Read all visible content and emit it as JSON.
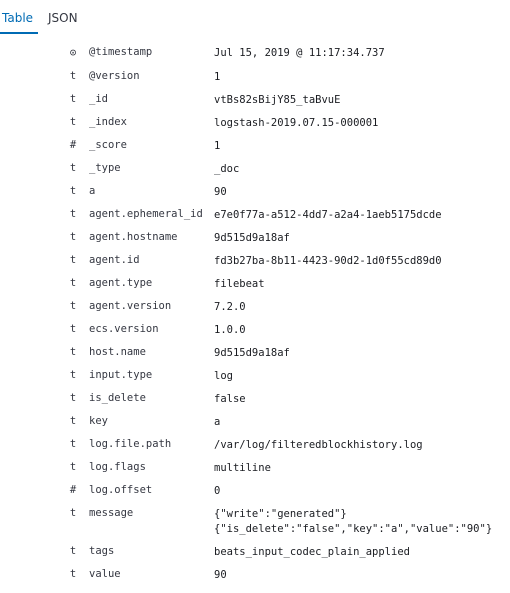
{
  "tabs": {
    "table": "Table",
    "json": "JSON"
  },
  "icons": {
    "date": "clock-icon",
    "string": "t",
    "number": "#"
  },
  "rows": [
    {
      "type": "⊙",
      "field": "@timestamp",
      "value": "Jul 15, 2019 @ 11:17:34.737"
    },
    {
      "type": "t",
      "field": "@version",
      "value": "1"
    },
    {
      "type": "t",
      "field": "_id",
      "value": "vtBs82sBijY85_taBvuE"
    },
    {
      "type": "t",
      "field": "_index",
      "value": "logstash-2019.07.15-000001"
    },
    {
      "type": "#",
      "field": "_score",
      "value": "1"
    },
    {
      "type": "t",
      "field": "_type",
      "value": "_doc"
    },
    {
      "type": "t",
      "field": "a",
      "value": "90"
    },
    {
      "type": "t",
      "field": "agent.ephemeral_id",
      "value": "e7e0f77a-a512-4dd7-a2a4-1aeb5175dcde"
    },
    {
      "type": "t",
      "field": "agent.hostname",
      "value": "9d515d9a18af"
    },
    {
      "type": "t",
      "field": "agent.id",
      "value": "fd3b27ba-8b11-4423-90d2-1d0f55cd89d0"
    },
    {
      "type": "t",
      "field": "agent.type",
      "value": "filebeat"
    },
    {
      "type": "t",
      "field": "agent.version",
      "value": "7.2.0"
    },
    {
      "type": "t",
      "field": "ecs.version",
      "value": "1.0.0"
    },
    {
      "type": "t",
      "field": "host.name",
      "value": "9d515d9a18af"
    },
    {
      "type": "t",
      "field": "input.type",
      "value": "log"
    },
    {
      "type": "t",
      "field": "is_delete",
      "value": "false"
    },
    {
      "type": "t",
      "field": "key",
      "value": "a"
    },
    {
      "type": "t",
      "field": "log.file.path",
      "value": "/var/log/filteredblockhistory.log"
    },
    {
      "type": "t",
      "field": "log.flags",
      "value": "multiline"
    },
    {
      "type": "#",
      "field": "log.offset",
      "value": "0"
    },
    {
      "type": "t",
      "field": "message",
      "value": "{\"write\":\"generated\"}\n{\"is_delete\":\"false\",\"key\":\"a\",\"value\":\"90\"}"
    },
    {
      "type": "t",
      "field": "tags",
      "value": "beats_input_codec_plain_applied"
    },
    {
      "type": "t",
      "field": "value",
      "value": "90"
    }
  ]
}
